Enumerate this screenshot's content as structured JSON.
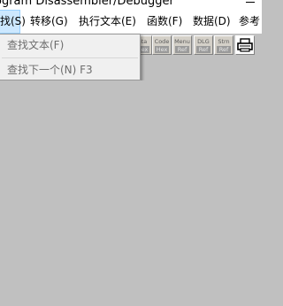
{
  "window": {
    "title": "ogram Disassembler/Debugger"
  },
  "menubar": {
    "items": [
      {
        "label": "找(S)"
      },
      {
        "label": "转移(G)"
      },
      {
        "label": "执行文本(E)"
      },
      {
        "label": "函数(F)"
      },
      {
        "label": "数据(D)"
      },
      {
        "label": "参考"
      }
    ]
  },
  "dropdown": {
    "items": [
      {
        "label": "查找文本(F)"
      },
      {
        "label": "查找下一个(N) F3"
      }
    ]
  },
  "toolbar": {
    "buttons": [
      {
        "line1": "ata",
        "line2": "Hex",
        "icon": "data-hex-icon"
      },
      {
        "line1": "Code",
        "line2": "Hex",
        "icon": "code-hex-icon"
      },
      {
        "line1": "Menu",
        "line2": "Ref",
        "icon": "menu-ref-icon"
      },
      {
        "line1": "DLG",
        "line2": "Ref",
        "icon": "dlg-ref-icon"
      },
      {
        "line1": "Strn",
        "line2": "Ref",
        "icon": "string-ref-icon"
      },
      {
        "icon": "printer-icon"
      }
    ]
  }
}
